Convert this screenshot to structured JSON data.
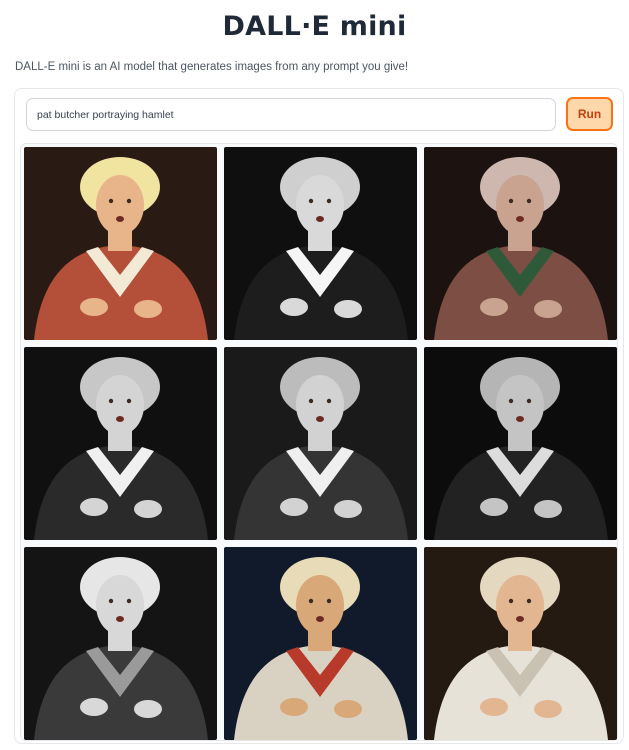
{
  "header": {
    "title": "DALL·E mini",
    "description": "DALL-E mini is an AI model that generates images from any prompt you give!"
  },
  "prompt": {
    "value": "pat butcher portraying hamlet"
  },
  "run_button": {
    "label": "Run"
  },
  "colors": {
    "accent_border": "#f97316",
    "accent_fill": "#fed7aa",
    "accent_text": "#c2410c"
  },
  "gallery": {
    "images": [
      {
        "bg": "#2a1a14",
        "skin": "#e8b48a",
        "hair": "#f1e3a0",
        "robe": "#b4503a",
        "trim": "#f3ead6"
      },
      {
        "bg": "#0f0f0f",
        "skin": "#d9d9d9",
        "hair": "#cfcfcf",
        "robe": "#1d1d1d",
        "trim": "#f5f5f5"
      },
      {
        "bg": "#1c1210",
        "skin": "#c9a390",
        "hair": "#cdb7ae",
        "robe": "#7c4e44",
        "trim": "#2e5a3a"
      },
      {
        "bg": "#101010",
        "skin": "#d4d4d4",
        "hair": "#c7c7c7",
        "robe": "#2a2a2a",
        "trim": "#f0f0f0"
      },
      {
        "bg": "#1a1a1a",
        "skin": "#d2d2d2",
        "hair": "#bcbcbc",
        "robe": "#343434",
        "trim": "#efefef"
      },
      {
        "bg": "#0c0c0c",
        "skin": "#c4c4c4",
        "hair": "#b5b5b5",
        "robe": "#222222",
        "trim": "#dcdcdc"
      },
      {
        "bg": "#141414",
        "skin": "#d8d8d8",
        "hair": "#e6e6e6",
        "robe": "#3a3a3a",
        "trim": "#9a9a9a"
      },
      {
        "bg": "#101a2a",
        "skin": "#d9a878",
        "hair": "#e8dcb8",
        "robe": "#d9d2c3",
        "trim": "#b83a2a"
      },
      {
        "bg": "#241a12",
        "skin": "#e3b692",
        "hair": "#e4d9c0",
        "robe": "#e6e2d8",
        "trim": "#c9c2b2"
      }
    ]
  }
}
